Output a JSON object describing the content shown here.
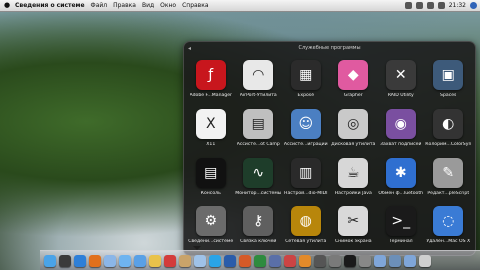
{
  "menubar": {
    "app_name": "Сведения о системе",
    "items": [
      "Файл",
      "Правка",
      "Вид",
      "Окно",
      "Справка"
    ],
    "clock": "21:32"
  },
  "stack": {
    "title": "Служебные программы",
    "apps": [
      {
        "label": "Adobe F...Manager",
        "icon": "flash-icon",
        "color": "#c8161d",
        "glyph": "ƒ"
      },
      {
        "label": "AirPort-Утилита",
        "icon": "airport-icon",
        "color": "#e8e8e8",
        "glyph": "◠"
      },
      {
        "label": "Exposé",
        "icon": "expose-icon",
        "color": "#2b2b2b",
        "glyph": "▦"
      },
      {
        "label": "Grapher",
        "icon": "grapher-icon",
        "color": "#e05aa0",
        "glyph": "◆"
      },
      {
        "label": "RAID Utility",
        "icon": "raid-icon",
        "color": "#3a3a3a",
        "glyph": "✕"
      },
      {
        "label": "Spaces",
        "icon": "spaces-icon",
        "color": "#3d5a7a",
        "glyph": "▣"
      },
      {
        "label": "X11",
        "icon": "x11-icon",
        "color": "#f2f2f2",
        "glyph": "X"
      },
      {
        "label": "Ассисте...ot Camp",
        "icon": "bootcamp-icon",
        "color": "#bfbfbf",
        "glyph": "▤"
      },
      {
        "label": "Ассисте...играции",
        "icon": "migration-icon",
        "color": "#4b7fc2",
        "glyph": "☺"
      },
      {
        "label": "Дисковая утилита",
        "icon": "disk-utility-icon",
        "color": "#c9c9c9",
        "glyph": "◎"
      },
      {
        "label": "Захват подписей",
        "icon": "podcast-capture-icon",
        "color": "#7a4fa0",
        "glyph": "◉"
      },
      {
        "label": "Колорим...ColorSync",
        "icon": "colorsync-icon",
        "color": "#333333",
        "glyph": "◐"
      },
      {
        "label": "Консоль",
        "icon": "console-icon",
        "color": "#111111",
        "glyph": "▤"
      },
      {
        "label": "Монитор...системы",
        "icon": "activity-monitor-icon",
        "color": "#1e3d2a",
        "glyph": "∿"
      },
      {
        "label": "Настрой...dio-MIDI",
        "icon": "audio-midi-icon",
        "color": "#2a2a2a",
        "glyph": "▥"
      },
      {
        "label": "Настройки Java",
        "icon": "java-icon",
        "color": "#d7d7d7",
        "glyph": "☕"
      },
      {
        "label": "Обмен ф...luetooth",
        "icon": "bluetooth-icon",
        "color": "#2f6fd0",
        "glyph": "✱"
      },
      {
        "label": "Редакт...pleScript",
        "icon": "applescript-icon",
        "color": "#9a9a9a",
        "glyph": "✎"
      },
      {
        "label": "Сведени...системе",
        "icon": "system-profiler-icon",
        "color": "#6b6b6b",
        "glyph": "⚙"
      },
      {
        "label": "Связка ключей",
        "icon": "keychain-icon",
        "color": "#5f5f5f",
        "glyph": "⚷"
      },
      {
        "label": "Сетевая утилита",
        "icon": "network-utility-icon",
        "color": "#b8860b",
        "glyph": "◍"
      },
      {
        "label": "Снимок экрана",
        "icon": "grab-icon",
        "color": "#d9d9d9",
        "glyph": "✂"
      },
      {
        "label": "Терминал",
        "icon": "terminal-icon",
        "color": "#1a1a1a",
        "glyph": ">_"
      },
      {
        "label": "Удален...Mac OS X",
        "icon": "remote-install-icon",
        "color": "#3a7bd5",
        "glyph": "◌"
      }
    ]
  },
  "dock": {
    "items": [
      {
        "icon": "finder-icon",
        "color": "#4aa3e8"
      },
      {
        "icon": "dashboard-icon",
        "color": "#3b3b3b"
      },
      {
        "icon": "safari-icon",
        "color": "#2e7fd8"
      },
      {
        "icon": "firefox-icon",
        "color": "#e1701d"
      },
      {
        "icon": "mail-icon",
        "color": "#8bb6e8"
      },
      {
        "icon": "ichat-icon",
        "color": "#6fb4f0"
      },
      {
        "icon": "itunes-icon",
        "color": "#5aa0e6"
      },
      {
        "icon": "iphoto-icon",
        "color": "#e9c24b"
      },
      {
        "icon": "calendar-icon",
        "color": "#d33b3b"
      },
      {
        "icon": "address-book-icon",
        "color": "#c9a36a"
      },
      {
        "icon": "preview-icon",
        "color": "#9fc2e8"
      },
      {
        "icon": "skype-icon",
        "color": "#2aa4e8"
      },
      {
        "icon": "word-icon",
        "color": "#2a5caa"
      },
      {
        "icon": "powerpoint-icon",
        "color": "#d55a28"
      },
      {
        "icon": "excel-icon",
        "color": "#2e8b3e"
      },
      {
        "icon": "quicktime-icon",
        "color": "#5a6fa8"
      },
      {
        "icon": "app-icon",
        "color": "#c44"
      },
      {
        "icon": "app-icon",
        "color": "#e28a2a"
      },
      {
        "icon": "app-icon",
        "color": "#555"
      },
      {
        "icon": "app-icon",
        "color": "#7a7a7a"
      },
      {
        "icon": "terminal-icon",
        "color": "#1a1a1a"
      },
      {
        "icon": "app-icon",
        "color": "#888"
      },
      {
        "icon": "folder-icon",
        "color": "#7fa6d9"
      },
      {
        "icon": "utilities-stack-icon",
        "color": "#6c8fb8"
      },
      {
        "icon": "folder-icon",
        "color": "#7fa6d9"
      },
      {
        "icon": "trash-icon",
        "color": "#cfcfcf"
      }
    ]
  }
}
